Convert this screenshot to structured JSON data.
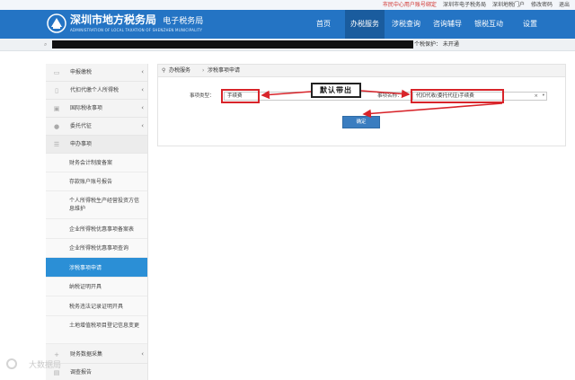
{
  "top_links": [
    {
      "label": "市民中心用户账号绑定",
      "highlight": true
    },
    {
      "label": "深圳市电子税务局",
      "highlight": false
    },
    {
      "label": "深圳地税门户",
      "highlight": false
    },
    {
      "label": "修改密码",
      "highlight": false
    },
    {
      "label": "退出",
      "highlight": false
    }
  ],
  "header": {
    "title": "深圳市地方税务局",
    "subtitle": "电子税务局",
    "english": "ADMINISTRATION OF LOCAL TAXATION OF SHENZHEN MUNICIPALITY"
  },
  "nav": [
    {
      "label": "首页",
      "active": false
    },
    {
      "label": "办税服务",
      "active": true
    },
    {
      "label": "涉税查询",
      "active": false
    },
    {
      "label": "咨询辅导",
      "active": false
    },
    {
      "label": "银税互动",
      "active": false
    },
    {
      "label": "设置",
      "active": false
    }
  ],
  "user_strip": {
    "status": "个税保护：  未开通"
  },
  "sidebar": {
    "groups": [
      {
        "label": "申报缴税"
      },
      {
        "label": "代扣代缴个人所得税"
      },
      {
        "label": "国际税收事项"
      },
      {
        "label": "委托代征"
      },
      {
        "label": "申办事项"
      }
    ],
    "sub_items": [
      {
        "label": "财务会计制度备案"
      },
      {
        "label": "存款账户账号报告"
      },
      {
        "label": "个人所得税生产经营投资方信息维护"
      },
      {
        "label": "企业所得税优惠事项备案表"
      },
      {
        "label": "企业所得税优惠事项查询"
      },
      {
        "label": "涉税事项申请",
        "active": true
      },
      {
        "label": "纳税证明开具"
      },
      {
        "label": "税务违法记录证明开具"
      },
      {
        "label": "土地增值税项目登记信息变更"
      }
    ],
    "bottom_groups": [
      {
        "label": "财务数据采集"
      },
      {
        "label": "调查报告"
      }
    ]
  },
  "breadcrumb": {
    "section": "办税服务",
    "separator": "›",
    "page": "涉税事项申请"
  },
  "form": {
    "type_label": "事项类型：",
    "type_value": "手续费",
    "name_label": "事项名称：",
    "name_value": "代扣代收(委托代征)手续费",
    "clear_symbol": "×",
    "dropdown_symbol": "▾",
    "confirm_label": "确定"
  },
  "annotation": {
    "callout": "默认带出"
  },
  "watermark": {
    "text": "大数据局"
  }
}
